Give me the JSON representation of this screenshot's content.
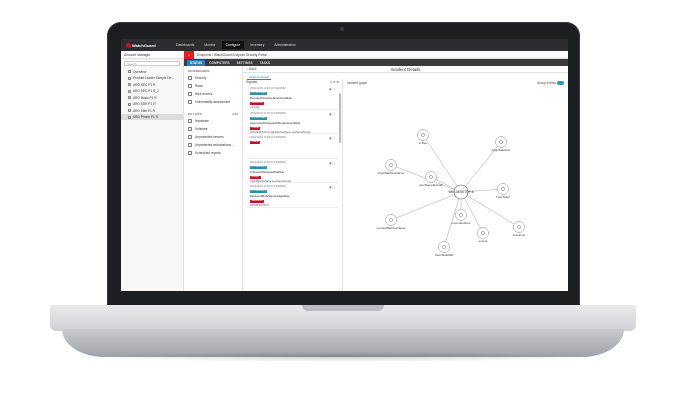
{
  "app": {
    "brand": "WatchGuard"
  },
  "nav_tabs": [
    "Dashboards",
    "Monitor",
    "Configure",
    "Inventory",
    "Administration"
  ],
  "nav_active": "Configure",
  "account": {
    "label": "Account Manager"
  },
  "search": {
    "placeholder": "Search"
  },
  "tree": [
    {
      "label": "Overview"
    },
    {
      "label": "Product Leader Sample De..."
    },
    {
      "label": "ARO SEC P1 R"
    },
    {
      "label": "ARO SEC P1 R_2"
    },
    {
      "label": "ARO Basic P1 R"
    },
    {
      "label": "ARO EDR P1 R"
    },
    {
      "label": "ARO Elite P1 R"
    },
    {
      "label": "ARO Phone P1 R"
    }
  ],
  "breadcrumb": {
    "text": "Endpoints / WatchGuard Endpoint Security Portal"
  },
  "subtabs": [
    "STATUS",
    "COMPUTERS",
    "SETTINGS",
    "TASKS"
  ],
  "subtab_active": "STATUS",
  "sections": {
    "dashboards": {
      "title": "DASHBOARDS",
      "items": [
        "Security",
        "Risks",
        "Web access",
        "Vulnerability assessment"
      ]
    },
    "mylists": {
      "title": "MY LISTS",
      "add": "Add",
      "items": [
        "Hardware",
        "Software",
        "Unprotected servers",
        "Unprotected workstations...",
        "Scheduled reports"
      ]
    }
  },
  "content": {
    "back": "Back",
    "title": "Incident Details",
    "subtab": "Incident details"
  },
  "signals": {
    "title": "Signals",
    "items": [
      {
        "date": "2024/11/03 11:48:13 1946459Z",
        "tag1": "ATT&CK/DEN",
        "title": "RemoteInteractiveSuspiciousRule",
        "tag2": "WARNING",
        "meta": "sourceip"
      },
      {
        "date": "2024/11/03 11:48:13 1946459Z",
        "tag1": "ATT&CK/DEN",
        "title": "AccountActivityLeakOrReplacementRule",
        "tag2": "Critical",
        "meta": "WIN-DESKTOP-6  originMachineName  userNameDomain"
      },
      {
        "date": "2024/11/03 11:48:13 1946459Z",
        "tag1": "",
        "title": "",
        "tag2": "Critical",
        "meta": ""
      },
      {
        "date": "2024/11/03 11:48:13 1946459Z",
        "tag1": "ATT&CK/DEN",
        "title": "UnknownPasswordFileRule",
        "tag2": "Danger",
        "meta": "originMachineName  userNameDomain"
      },
      {
        "date": "2024/11/03 11:48:13 1946459Z",
        "tag1": "ATT&CK/DEN",
        "title": "PasswordRoleNameUsageRule",
        "tag2": "WARNING",
        "meta": "WIN-DESKTOP-6"
      }
    ]
  },
  "graph": {
    "title": "Incident graph",
    "toggle_label": "Group events",
    "center": "WIN-DESKTOP-6",
    "nodes": [
      "2 files",
      "originMachine",
      "originMachineName",
      "userNameDomain",
      "UserTest2",
      "remoteMachineName",
      "commandLine",
      "sessionIp",
      "events",
      "UserTest0000"
    ]
  },
  "colors": {
    "brand_red": "#e31c23",
    "accent_blue": "#2a7fb6",
    "tag_red": "#c8102e",
    "tag_teal": "#2a8fa8"
  }
}
